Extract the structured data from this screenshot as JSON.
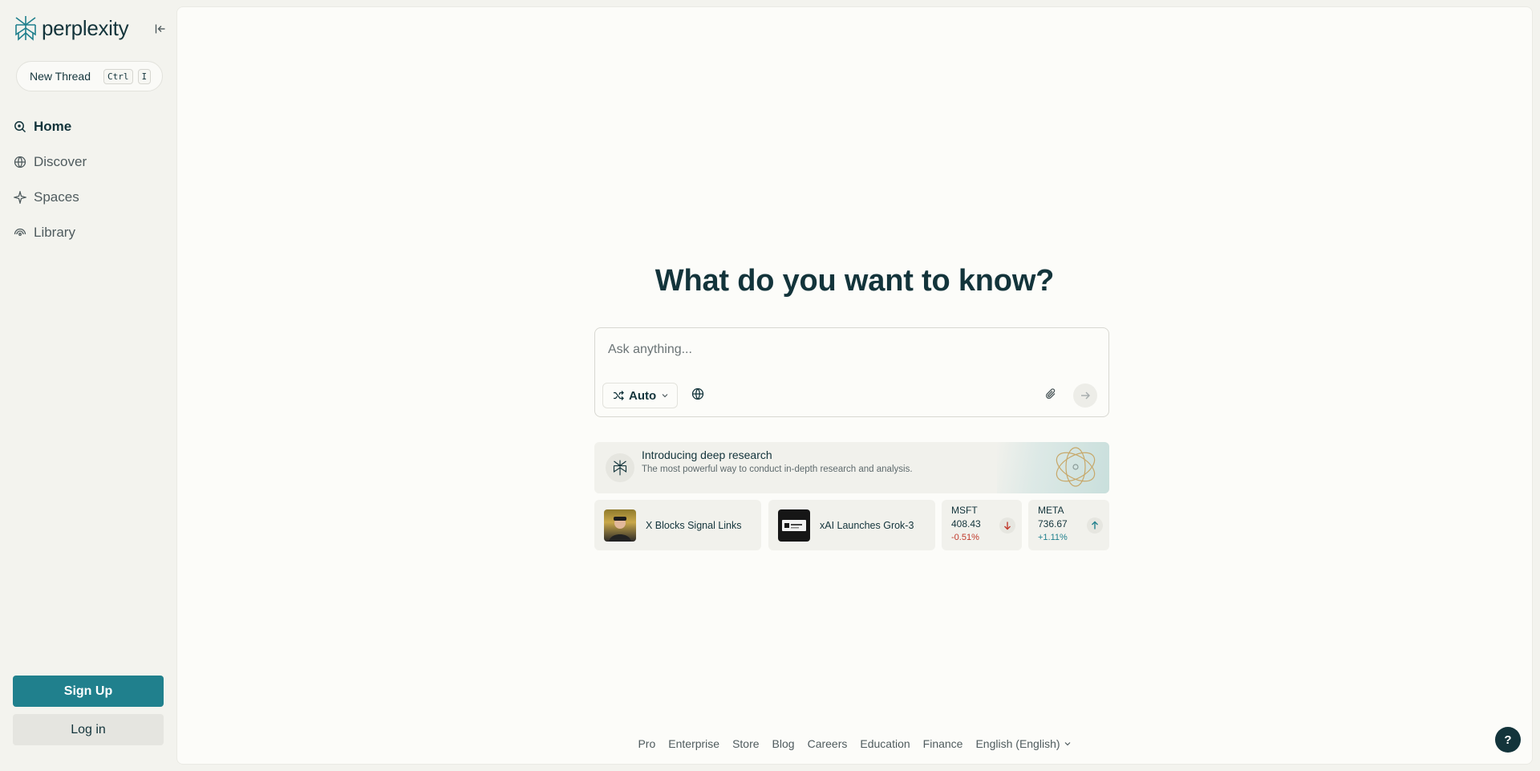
{
  "app": {
    "name": "perplexity"
  },
  "colors": {
    "accent": "#20808D",
    "text": "#13343B",
    "negative": "#C0392B",
    "positive": "#20808D",
    "sidebar_bg": "#F3F3EE",
    "main_bg": "#FCFCF9"
  },
  "sidebar": {
    "new_thread": {
      "label": "New Thread",
      "shortcut": [
        "Ctrl",
        "I"
      ]
    },
    "nav": [
      {
        "label": "Home",
        "icon": "home-search-icon",
        "active": true
      },
      {
        "label": "Discover",
        "icon": "globe-icon",
        "active": false
      },
      {
        "label": "Spaces",
        "icon": "spaces-icon",
        "active": false
      },
      {
        "label": "Library",
        "icon": "library-icon",
        "active": false
      }
    ],
    "signup_label": "Sign Up",
    "login_label": "Log in"
  },
  "main": {
    "headline": "What do you want to know?",
    "search": {
      "placeholder": "Ask anything...",
      "mode_label": "Auto"
    },
    "promo": {
      "title": "Introducing deep research",
      "description": "The most powerful way to conduct in-depth research and analysis."
    },
    "news": [
      {
        "title": "X Blocks Signal Links"
      },
      {
        "title": "xAI Launches Grok-3"
      }
    ],
    "stocks": [
      {
        "ticker": "MSFT",
        "price": "408.43",
        "change": "-0.51%",
        "direction": "down"
      },
      {
        "ticker": "META",
        "price": "736.67",
        "change": "+1.11%",
        "direction": "up"
      }
    ]
  },
  "footer": {
    "links": [
      "Pro",
      "Enterprise",
      "Store",
      "Blog",
      "Careers",
      "Education",
      "Finance"
    ],
    "language": "English (English)"
  },
  "help_label": "?"
}
